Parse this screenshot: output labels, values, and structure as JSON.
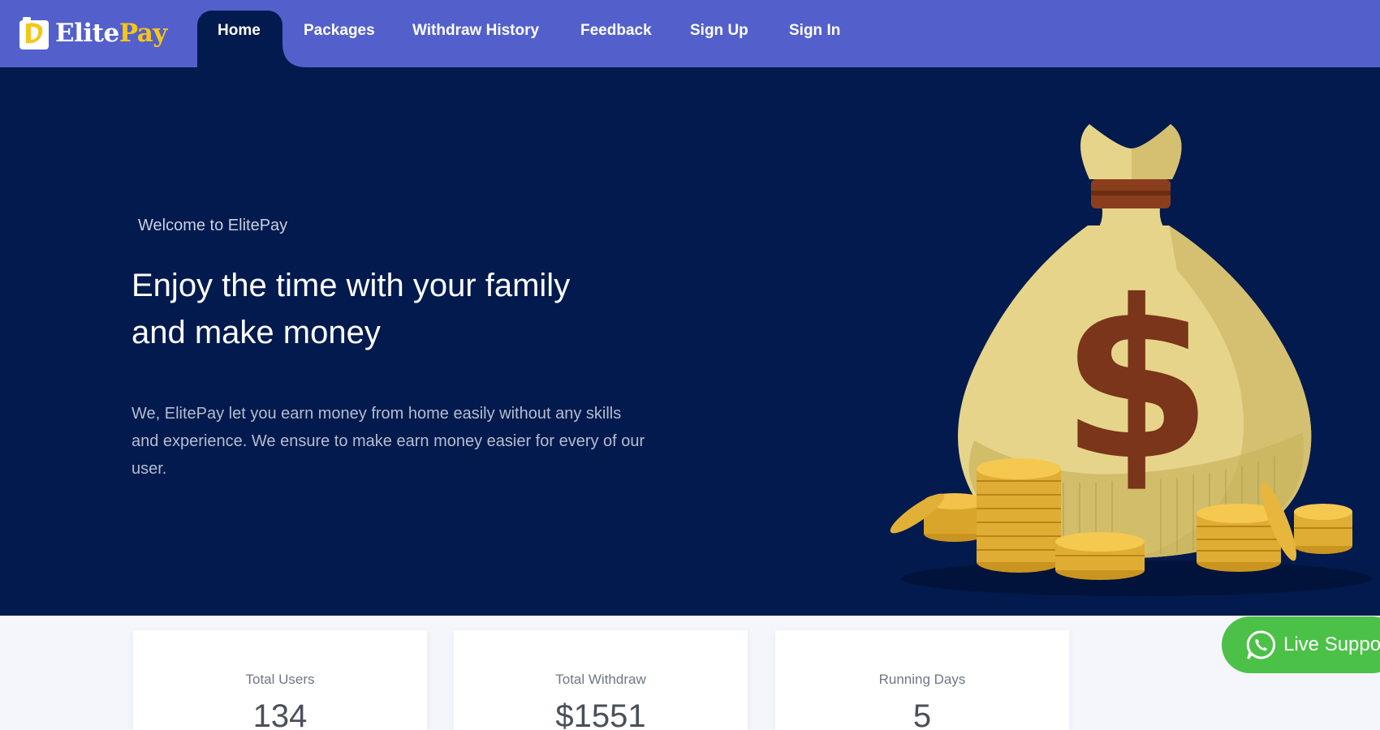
{
  "brand": {
    "name_part1": "Elite",
    "name_part2": "Pay",
    "logo_icon": "elitepay-logo-icon"
  },
  "nav": {
    "items": [
      {
        "label": "Home",
        "active": true
      },
      {
        "label": "Packages",
        "active": false
      },
      {
        "label": "Withdraw History",
        "active": false
      },
      {
        "label": "Feedback",
        "active": false
      },
      {
        "label": "Sign Up",
        "active": false
      },
      {
        "label": "Sign In",
        "active": false
      }
    ]
  },
  "hero": {
    "welcome": "Welcome to ElitePay",
    "heading_line1": "Enjoy the time with your family",
    "heading_line2": "and make money",
    "description": "We, ElitePay let you earn money from home easily without any skills and experience. We ensure to make earn money easier for every of our user.",
    "illustration": "money-bag-with-coins"
  },
  "stats": [
    {
      "label": "Total Users",
      "value": "134"
    },
    {
      "label": "Total Withdraw",
      "value": "$1551"
    },
    {
      "label": "Running Days",
      "value": "5"
    }
  ],
  "support": {
    "label": "Live Support",
    "icon": "whatsapp-icon"
  },
  "colors": {
    "nav_bg": "#5360cc",
    "hero_bg": "#021a4d",
    "brand_yellow": "#f5c518",
    "support_green": "#4cc148"
  }
}
